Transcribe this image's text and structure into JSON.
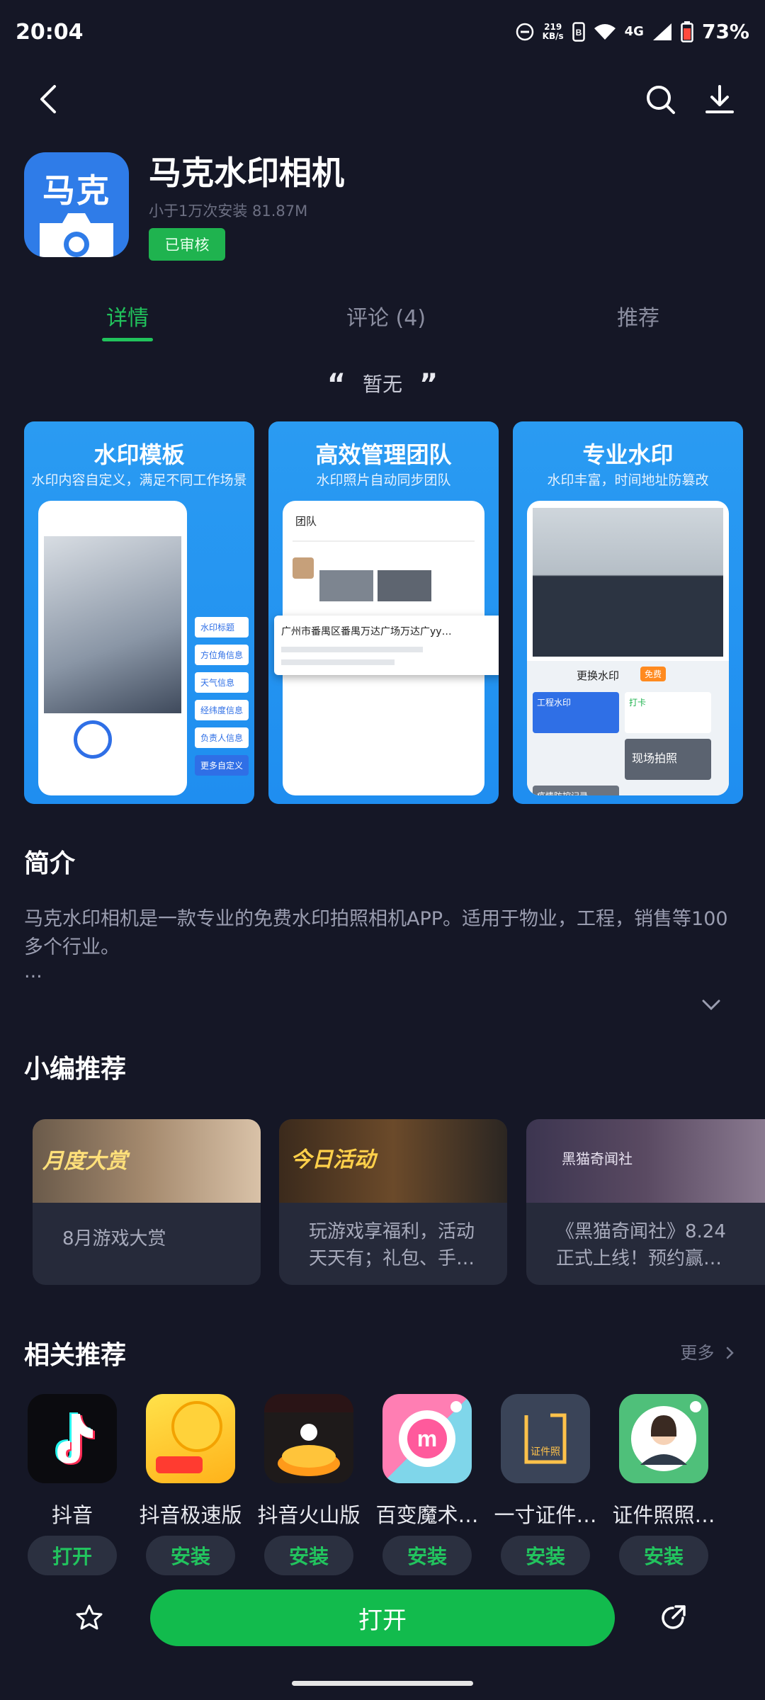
{
  "status_bar": {
    "time": "20:04",
    "net_speed_top": "219",
    "net_speed_bottom": "KB/s",
    "network": "4G",
    "battery": "73%"
  },
  "app": {
    "icon_text": "马克",
    "name": "马克水印相机",
    "meta": "小于1万次安装   81.87M",
    "badge": "已审核"
  },
  "tabs": [
    {
      "label": "详情",
      "active": true
    },
    {
      "label": "评论 (4)",
      "active": false
    },
    {
      "label": "推荐",
      "active": false
    }
  ],
  "quote": {
    "text": "暂无"
  },
  "screenshots": [
    {
      "title": "水印模板",
      "subtitle": "水印内容自定义，满足不同工作场景",
      "tags": [
        "水印标题",
        "方位角信息",
        "天气信息",
        "经纬度信息",
        "负责人信息",
        "更多自定义"
      ]
    },
    {
      "title": "高效管理团队",
      "subtitle": "水印照片自动同步团队",
      "header": "团队",
      "location": "广州市番禺区番禺万达广场万达广yy…"
    },
    {
      "title": "专业水印",
      "subtitle": "水印丰富，时间地址防篡改",
      "change_label": "更换水印",
      "free_label": "免费",
      "tiles": [
        "工程水印",
        "打卡",
        "现场拍照",
        "疫情防控记录"
      ]
    }
  ],
  "intro": {
    "title": "简介",
    "text": "马克水印相机是一款专业的免费水印拍照相机APP。适用于物业，工程，销售等100多个行业。",
    "ellipsis": "..."
  },
  "editor_picks": {
    "title": "小编推荐",
    "items": [
      {
        "banner": "月度大赏",
        "text": "8月游戏大赏"
      },
      {
        "banner": "今日活动",
        "text": "玩游戏享福利，活动天天有；礼包、手…"
      },
      {
        "banner": "黑猫奇闻社",
        "text": "《黑猫奇闻社》8.24正式上线！预约赢…"
      }
    ]
  },
  "related": {
    "title": "相关推荐",
    "more": "更多",
    "apps": [
      {
        "name": "抖音",
        "button": "打开"
      },
      {
        "name": "抖音极速版",
        "button": "安装"
      },
      {
        "name": "抖音火山版",
        "button": "安装"
      },
      {
        "name": "百变魔术…",
        "button": "安装"
      },
      {
        "name": "一寸证件…",
        "button": "安装"
      },
      {
        "name": "证件照照…",
        "button": "安装"
      }
    ]
  },
  "bottom_bar": {
    "open_label": "打开"
  }
}
